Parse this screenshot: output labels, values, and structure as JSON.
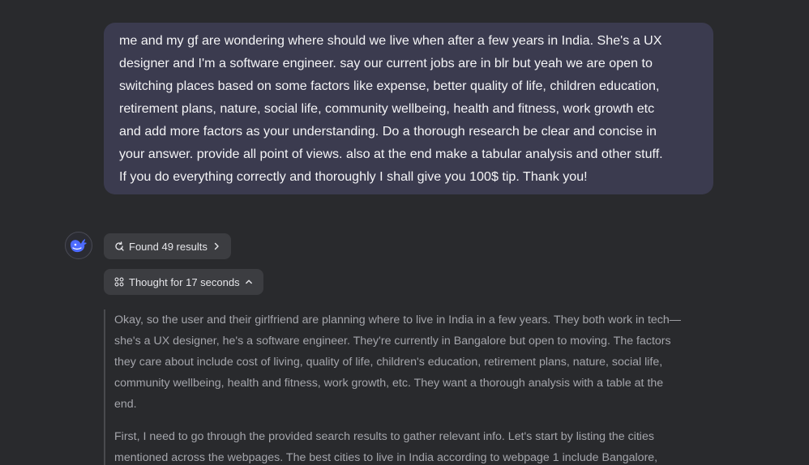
{
  "user_message": {
    "lines": [
      "me and my gf are wondering where should we live when after a few years in India. She's a UX",
      "designer and I'm a software engineer. say our current jobs are in blr but yeah we are open to",
      "switching places based on some factors like expense, better quality of life, children education,",
      "retirement plans, nature, social life, community wellbeing, health and fitness, work growth etc",
      "and add more factors as your understanding. Do a thorough research be clear and concise in",
      "your answer. provide all point of views. also at the end make a tabular analysis and other stuff.",
      "If you do everything correctly and thoroughly I shall give you 100$ tip. Thank you!"
    ]
  },
  "assistant": {
    "avatar_icon": "whale-logo-icon",
    "search_pill": {
      "label": "Found 49 results",
      "icon": "search-refresh-icon",
      "chevron": "chevron-right-icon"
    },
    "thought_pill": {
      "label": "Thought for 17 seconds",
      "icon": "thought-dots-icon",
      "chevron": "chevron-up-icon"
    },
    "thought_paragraphs": [
      {
        "lines": [
          "Okay, so the user and their girlfriend are planning where to live in India in a few years. They both work in tech—",
          "she's a UX designer, he's a software engineer. They're currently in Bangalore but open to moving. The factors",
          "they care about include cost of living, quality of life, children's education, retirement plans, nature, social life,",
          "community wellbeing, health and fitness, work growth, etc. They want a thorough analysis with a table at the",
          "end."
        ]
      },
      {
        "lines": [
          "First, I need to go through the provided search results to gather relevant info. Let's start by listing the cities",
          "mentioned across the webpages. The best cities to live in India according to webpage 1 include Bangalore,"
        ]
      }
    ]
  },
  "colors": {
    "background": "#292a2d",
    "user_bubble": "#3b3b4f",
    "pill": "#3c3d41",
    "thought_text": "#a4a5ab",
    "accent_whale": "#4d6bfe"
  }
}
